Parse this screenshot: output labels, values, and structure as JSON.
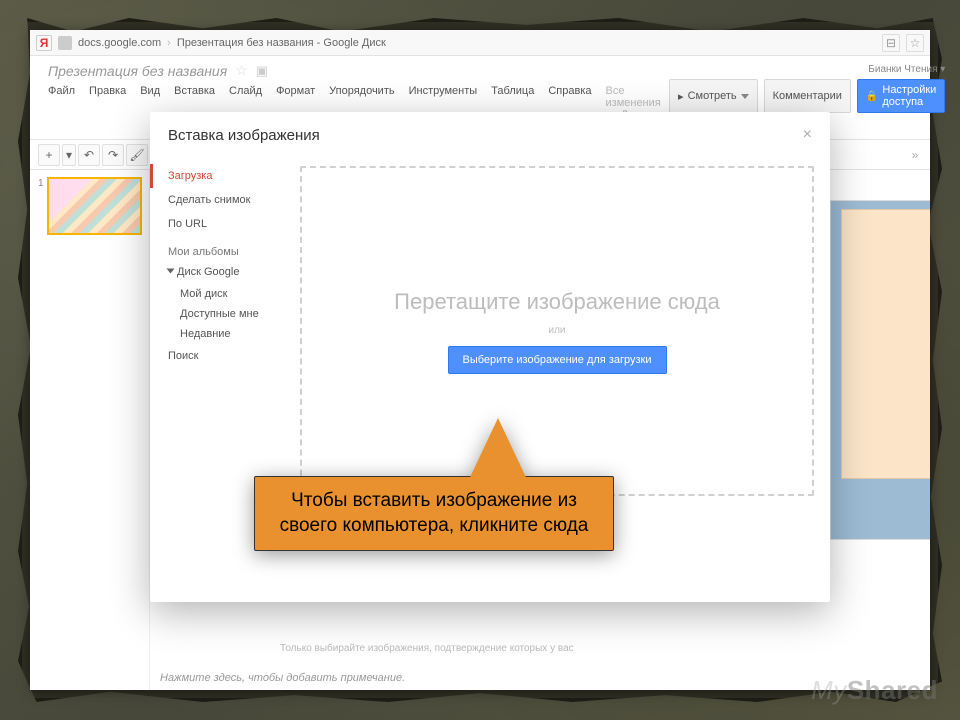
{
  "browser": {
    "yandex_letter": "Я",
    "domain": "docs.google.com",
    "separator": "›",
    "tab_title": "Презентация без названия - Google Диск"
  },
  "header": {
    "doc_title": "Презентация без названия",
    "account": "Бианки Чтения",
    "view_btn": "Смотреть",
    "comments_btn": "Комментарии",
    "share_btn": "Настройки доступа",
    "saved_msg": "Все изменения на Диске сохранены"
  },
  "menus": [
    "Файл",
    "Правка",
    "Вид",
    "Вставка",
    "Слайд",
    "Формат",
    "Упорядочить",
    "Инструменты",
    "Таблица",
    "Справка"
  ],
  "thumb": {
    "num": "1"
  },
  "footer_hint": "Только выбирайте изображения, подтверждение которых у вас",
  "speaker_hint": "Нажмите здесь, чтобы добавить примечание.",
  "modal": {
    "title": "Вставка изображения",
    "close": "×",
    "items": {
      "upload": "Загрузка",
      "snapshot": "Сделать снимок",
      "by_url": "По URL",
      "albums": "Мои альбомы",
      "drive": "Диск Google",
      "my_drive": "Мой диск",
      "shared": "Доступные мне",
      "recent": "Недавние",
      "search": "Поиск"
    },
    "drop_text": "Перетащите изображение сюда",
    "or": "или",
    "choose_btn": "Выберите изображение для загрузки"
  },
  "callout": "Чтобы вставить изображение из своего компьютера, кликните сюда",
  "watermark": {
    "a": "My",
    "b": "Shared"
  }
}
